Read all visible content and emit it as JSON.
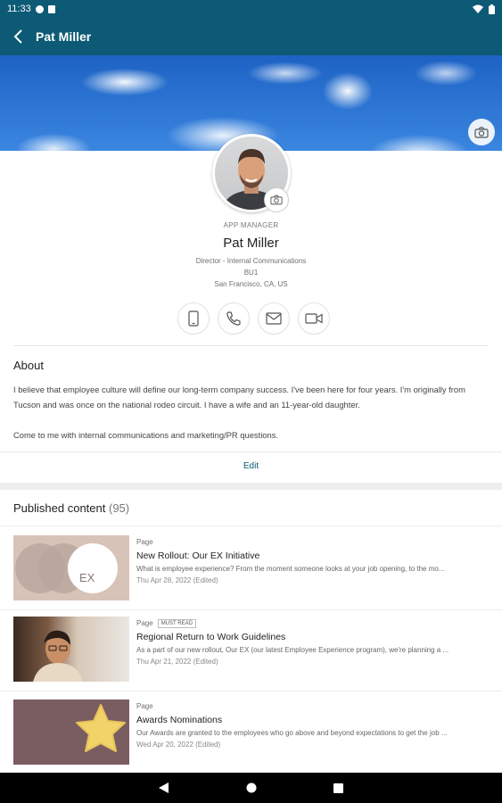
{
  "status_bar": {
    "time": "11:33"
  },
  "app_bar": {
    "title": "Pat Miller"
  },
  "profile": {
    "role_label": "APP MANAGER",
    "name": "Pat Miller",
    "title_line": "Director - Internal Communications",
    "unit": "BU1",
    "location": "San Francisco, CA, US"
  },
  "contact_actions": [
    {
      "icon": "mobile-phone-icon"
    },
    {
      "icon": "phone-icon"
    },
    {
      "icon": "email-icon"
    },
    {
      "icon": "video-icon"
    }
  ],
  "about": {
    "heading": "About",
    "paragraph_1": "I believe that employee culture will define our long-term company success. I've been here for four years. I'm originally from Tucson and was once on the national rodeo circuit. I have a wife and an 11-year-old daughter.",
    "paragraph_2": "Come to me with internal communications and marketing/PR questions.",
    "edit_label": "Edit"
  },
  "published": {
    "heading": "Published content",
    "count": "(95)",
    "items": [
      {
        "type": "Page",
        "badge": "",
        "title": "New Rollout: Our EX Initiative",
        "description": "What is employee experience? From the moment someone looks at your job opening, to the mo...",
        "date": "Thu Apr 28, 2022 (Edited)",
        "thumb_text": "EX"
      },
      {
        "type": "Page",
        "badge": "MUST READ",
        "title": "Regional Return to Work Guidelines",
        "description": "As a part of our new rollout, Our EX (our latest Employee Experience program), we're planning a ...",
        "date": "Thu Apr 21, 2022 (Edited)",
        "thumb_text": ""
      },
      {
        "type": "Page",
        "badge": "",
        "title": "Awards Nominations",
        "description": "Our Awards are granted to the employees who go above and beyond expectations to get the job ...",
        "date": "Wed Apr 20, 2022 (Edited)",
        "thumb_text": ""
      }
    ]
  }
}
